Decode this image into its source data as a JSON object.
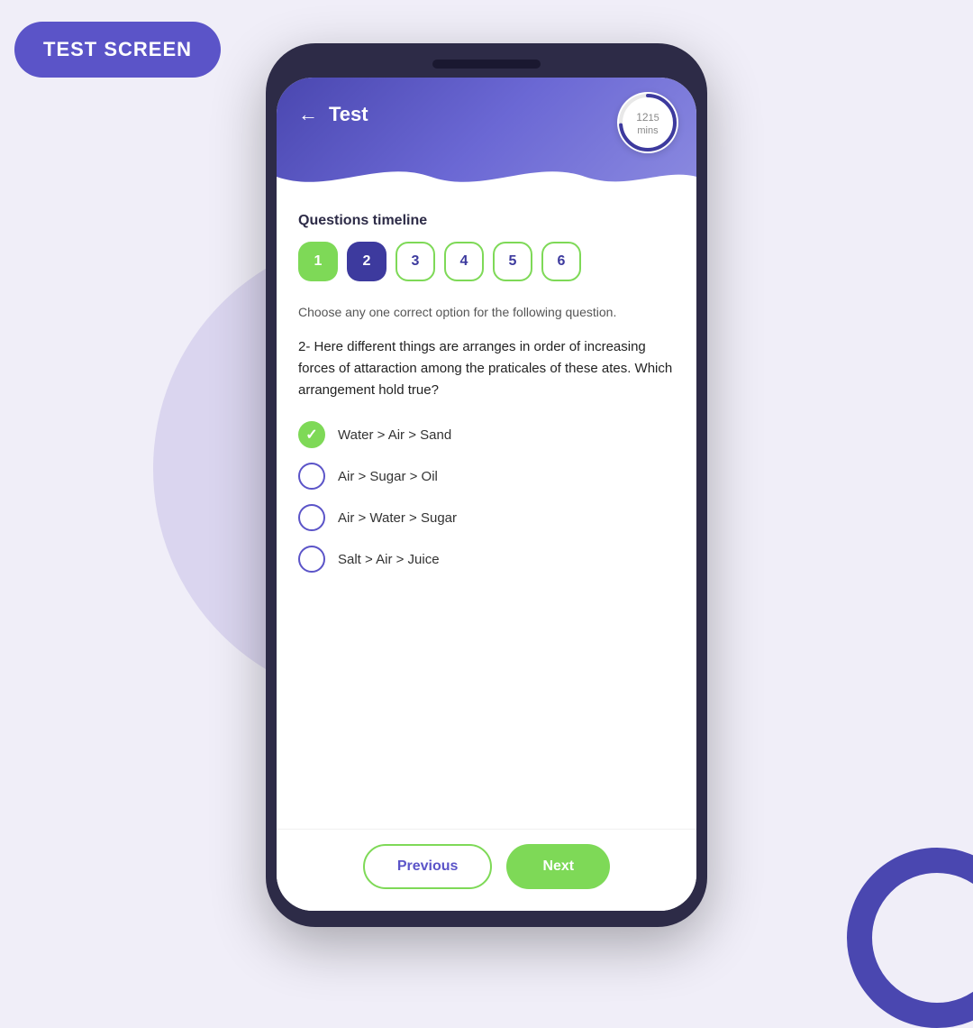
{
  "app_label": "TEST SCREEN",
  "header": {
    "back_label": "←",
    "title": "Test",
    "timer": {
      "current": "12",
      "total": "15",
      "unit": "mins"
    }
  },
  "questions_timeline": {
    "label": "Questions timeline",
    "bubbles": [
      {
        "number": "1",
        "state": "answered"
      },
      {
        "number": "2",
        "state": "active"
      },
      {
        "number": "3",
        "state": "inactive"
      },
      {
        "number": "4",
        "state": "inactive"
      },
      {
        "number": "5",
        "state": "inactive"
      },
      {
        "number": "6",
        "state": "inactive"
      }
    ]
  },
  "instruction": "Choose any one correct option for the following question.",
  "question": "2- Here different things are arranges in order of increasing forces of attaraction among the praticales of these ates. Which arrangement hold true?",
  "options": [
    {
      "text": "Water > Air > Sand",
      "selected": true
    },
    {
      "text": "Air > Sugar > Oil",
      "selected": false
    },
    {
      "text": "Air > Water > Sugar",
      "selected": false
    },
    {
      "text": "Salt > Air > Juice",
      "selected": false
    }
  ],
  "footer": {
    "previous_label": "Previous",
    "next_label": "Next"
  }
}
